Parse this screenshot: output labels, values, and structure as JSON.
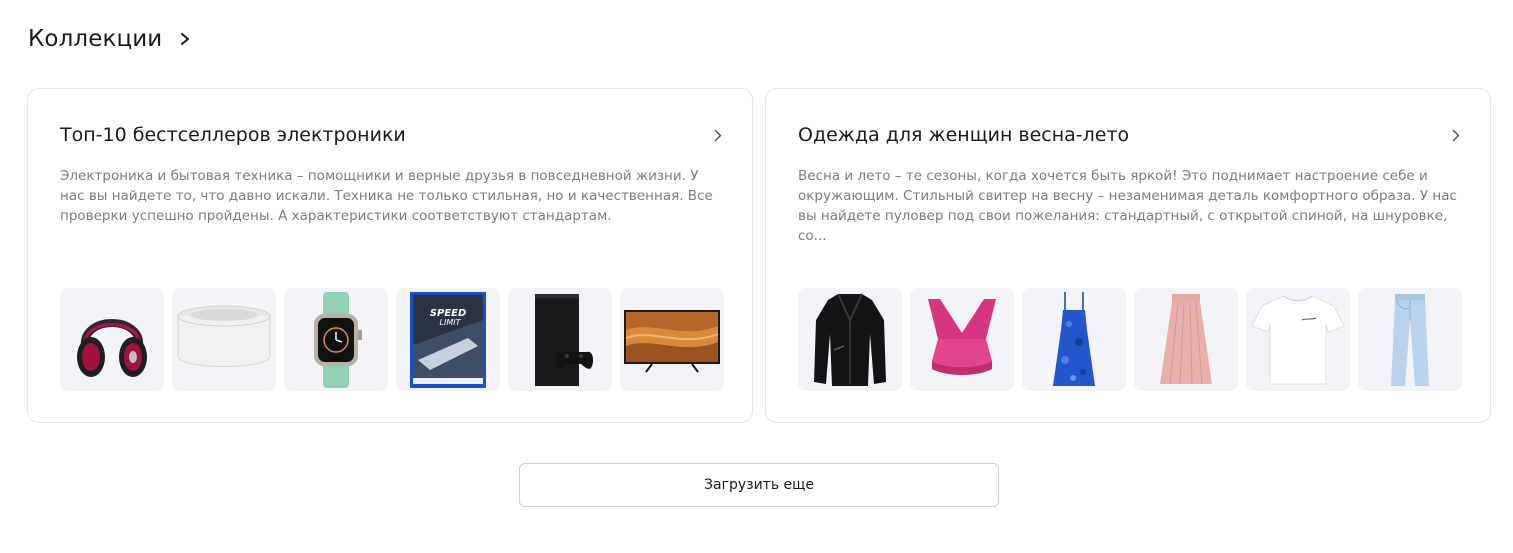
{
  "section": {
    "title": "Коллекции"
  },
  "collections": [
    {
      "title": "Топ-10 бестселлеров электроники",
      "description": "Электроника и бытовая техника – помощники и верные друзья в повседневной жизни. У нас вы найдете то, что давно искали. Техника не только стильная, но и качественная. Все проверки успешно пройдены. А характеристики соответствуют стандартам.",
      "products": [
        "headphones",
        "smart-speaker",
        "smartwatch",
        "game-disc",
        "game-console",
        "tv"
      ]
    },
    {
      "title": "Одежда для женщин весна-лето",
      "description": "Весна и лето – те сезоны, когда хочется быть яркой! Это поднимает настроение себе и окружающим. Стильный свитер на весну – незаменимая деталь комфортного образа. У нас вы найдете пуловер под свои пожелания: стандартный, с открытой спиной, на шнуровке, со...",
      "products": [
        "leather-jacket",
        "sports-bra",
        "dress",
        "pleated-skirt",
        "t-shirt",
        "jeans"
      ]
    }
  ],
  "game_cover_text": "SPEED LIMIT",
  "load_more_label": "Загрузить еще"
}
